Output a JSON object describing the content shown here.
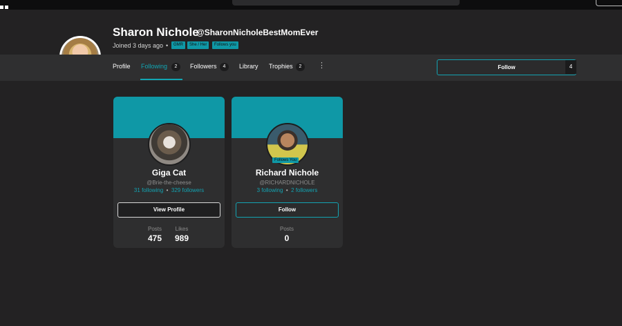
{
  "profile": {
    "name": "Sharon Nichole",
    "handle": "@SharonNicholeBestMomEver",
    "joined": "Joined 3 days ago",
    "badges": [
      "GMR",
      "She / Her",
      "Follows you"
    ]
  },
  "nav": {
    "tabs": [
      {
        "label": "Profile",
        "count": null
      },
      {
        "label": "Following",
        "count": "2"
      },
      {
        "label": "Followers",
        "count": "4"
      },
      {
        "label": "Library",
        "count": null
      },
      {
        "label": "Trophies",
        "count": "2"
      }
    ],
    "more_icon": "more-vertical-icon",
    "follow_button": {
      "label": "Follow",
      "count": "4"
    }
  },
  "cards": [
    {
      "name": "Giga Cat",
      "handle": "@Brie-the-cheese",
      "following": "31",
      "following_label": "following",
      "followers": "329",
      "followers_label": "followers",
      "button": "View Profile",
      "metrics": [
        {
          "label": "Posts",
          "value": "475"
        },
        {
          "label": "Likes",
          "value": "989"
        }
      ]
    },
    {
      "name": "Richard Nichole",
      "handle": "@RICHARDNICHOLE",
      "tag": "Follows You",
      "following": "3",
      "following_label": "following",
      "followers": "2",
      "followers_label": "followers",
      "button": "Follow",
      "metrics": [
        {
          "label": "Posts",
          "value": "0"
        }
      ]
    }
  ],
  "colors": {
    "accent": "#0f98a6",
    "background": "#232223",
    "card": "#2e2e2f"
  }
}
